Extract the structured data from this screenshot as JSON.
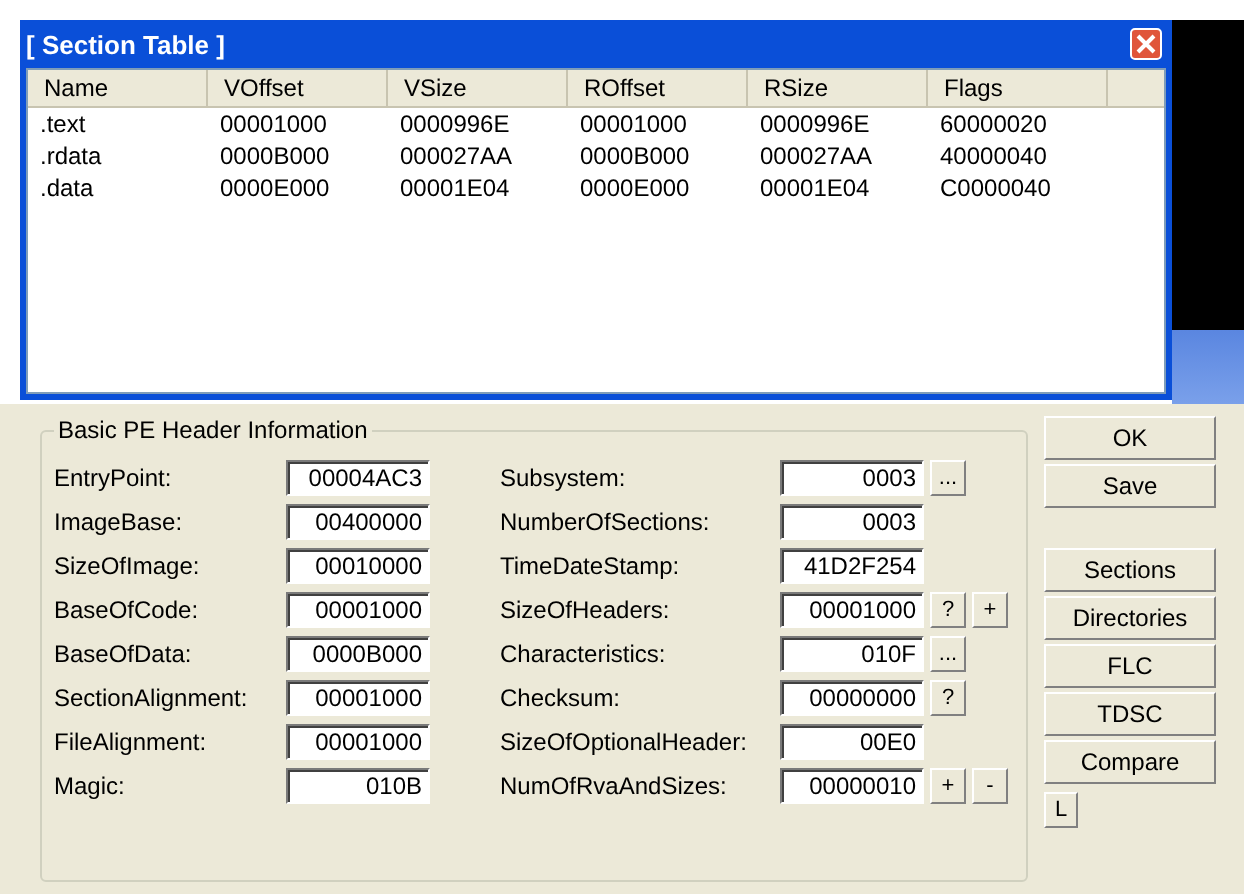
{
  "section_table": {
    "title": "[ Section Table ]",
    "columns": [
      "Name",
      "VOffset",
      "VSize",
      "ROffset",
      "RSize",
      "Flags"
    ],
    "rows": [
      [
        ".text",
        "00001000",
        "0000996E",
        "00001000",
        "0000996E",
        "60000020"
      ],
      [
        ".rdata",
        "0000B000",
        "000027AA",
        "0000B000",
        "000027AA",
        "40000040"
      ],
      [
        ".data",
        "0000E000",
        "00001E04",
        "0000E000",
        "00001E04",
        "C0000040"
      ]
    ]
  },
  "header_info": {
    "title": "Basic PE Header Information",
    "left_fields": [
      {
        "label": "EntryPoint:",
        "value": "00004AC3"
      },
      {
        "label": "ImageBase:",
        "value": "00400000"
      },
      {
        "label": "SizeOfImage:",
        "value": "00010000"
      },
      {
        "label": "BaseOfCode:",
        "value": "00001000"
      },
      {
        "label": "BaseOfData:",
        "value": "0000B000"
      },
      {
        "label": "SectionAlignment:",
        "value": "00001000"
      },
      {
        "label": "FileAlignment:",
        "value": "00001000"
      },
      {
        "label": "Magic:",
        "value": "010B"
      }
    ],
    "right_fields": [
      {
        "label": "Subsystem:",
        "value": "0003",
        "buttons": [
          "..."
        ]
      },
      {
        "label": "NumberOfSections:",
        "value": "0003"
      },
      {
        "label": "TimeDateStamp:",
        "value": "41D2F254"
      },
      {
        "label": "SizeOfHeaders:",
        "value": "00001000",
        "buttons": [
          "?",
          "+"
        ]
      },
      {
        "label": "Characteristics:",
        "value": "010F",
        "buttons": [
          "..."
        ]
      },
      {
        "label": "Checksum:",
        "value": "00000000",
        "buttons": [
          "?"
        ]
      },
      {
        "label": "SizeOfOptionalHeader:",
        "value": "00E0"
      },
      {
        "label": "NumOfRvaAndSizes:",
        "value": "00000010",
        "buttons": [
          "+",
          "-"
        ]
      }
    ]
  },
  "side_button_groups": [
    [
      "OK",
      "Save"
    ],
    [
      "Sections",
      "Directories",
      "FLC",
      "TDSC",
      "Compare"
    ]
  ],
  "small_button": "L"
}
